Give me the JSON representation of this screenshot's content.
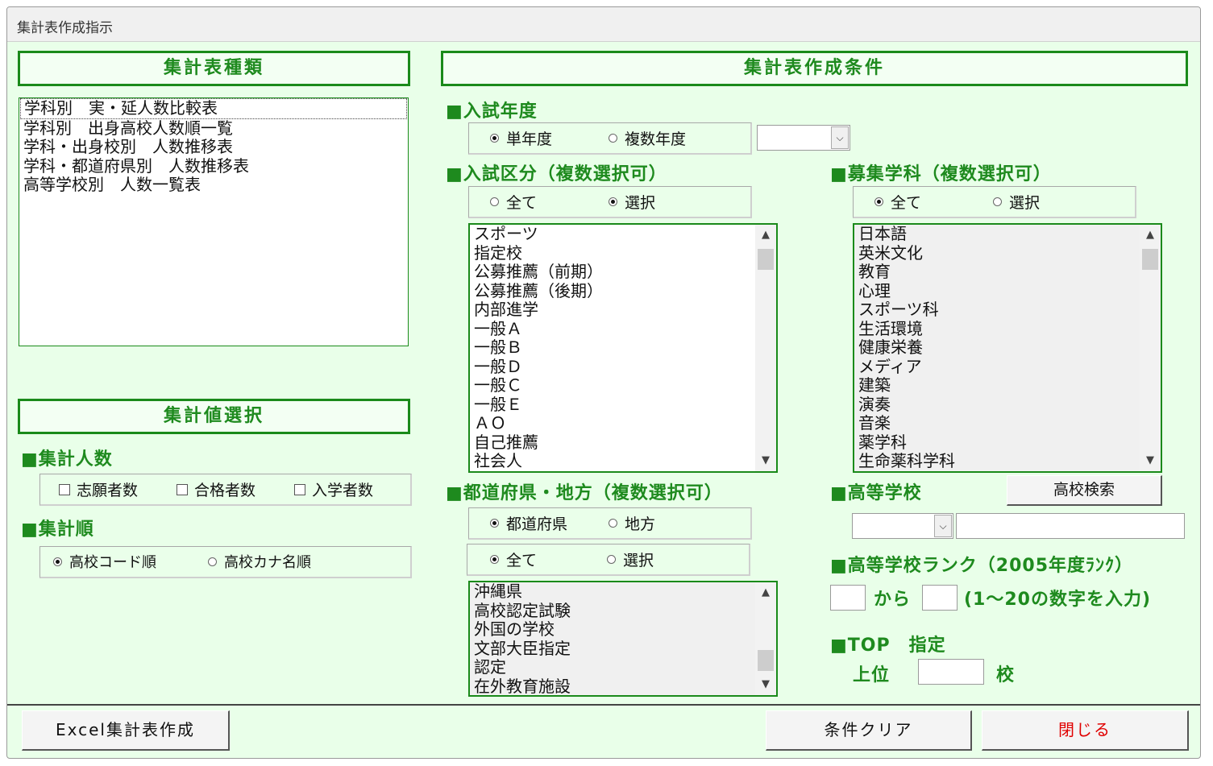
{
  "window": {
    "title": "集計表作成指示"
  },
  "left": {
    "table_type_header": "集計表種類",
    "table_types": [
      "学科別　実・延人数比較表",
      "学科別　出身高校人数順一覧",
      "学科・出身校別　人数推移表",
      "学科・都道府県別　人数推移表",
      "高等学校別　人数一覧表"
    ],
    "value_header": "集計値選択",
    "count_title": "■集計人数",
    "count_options": [
      "志願者数",
      "合格者数",
      "入学者数"
    ],
    "order_title": "■集計順",
    "order_options": [
      "高校コード順",
      "高校カナ名順"
    ],
    "order_selected": "高校コード順"
  },
  "right": {
    "conditions_header": "集計表作成条件",
    "year_title": "■入試年度",
    "year_options": [
      "単年度",
      "複数年度"
    ],
    "year_selected": "単年度",
    "year_value": "",
    "exam_title": "■入試区分（複数選択可）",
    "exam_mode": [
      "全て",
      "選択"
    ],
    "exam_mode_selected": "選択",
    "exam_items": [
      "スポーツ",
      "指定校",
      "公募推薦（前期）",
      "公募推薦（後期）",
      "内部進学",
      "一般Ａ",
      "一般Ｂ",
      "一般Ｄ",
      "一般Ｃ",
      "一般Ｅ",
      "ＡＯ",
      "自己推薦",
      "社会人"
    ],
    "dept_title": "■募集学科（複数選択可）",
    "dept_mode": [
      "全て",
      "選択"
    ],
    "dept_mode_selected": "全て",
    "dept_items": [
      "日本語",
      "英米文化",
      "教育",
      "心理",
      "スポーツ科",
      "生活環境",
      "健康栄養",
      "メディア",
      "建築",
      "演奏",
      "音楽",
      "薬学科",
      "生命薬科学科"
    ],
    "pref_title": "■都道府県・地方（複数選択可）",
    "pref_kind": [
      "都道府県",
      "地方"
    ],
    "pref_kind_selected": "都道府県",
    "pref_mode": [
      "全て",
      "選択"
    ],
    "pref_mode_selected": "全て",
    "pref_items": [
      "沖縄県",
      "高校認定試験",
      "外国の学校",
      "文部大臣指定",
      "認定",
      "在外教育施設"
    ],
    "school_title": "■高等学校",
    "school_search_button": "高校検索",
    "school_code": "",
    "school_name": "",
    "rank_title": "■高等学校ランク（2005年度ﾗﾝｸ）",
    "rank_from_label": "から",
    "rank_hint": "(1～20の数字を入力)",
    "rank_from": "",
    "rank_to": "",
    "top_title": "■TOP　指定",
    "top_prefix": "上位",
    "top_suffix": "校",
    "top_value": ""
  },
  "footer": {
    "excel_button": "Excel集計表作成",
    "clear_button": "条件クリア",
    "close_button": "閉じる",
    "close_color": "#e00000"
  },
  "colors": {
    "accent": "#1e8a1e",
    "background": "#e9ffe9"
  }
}
